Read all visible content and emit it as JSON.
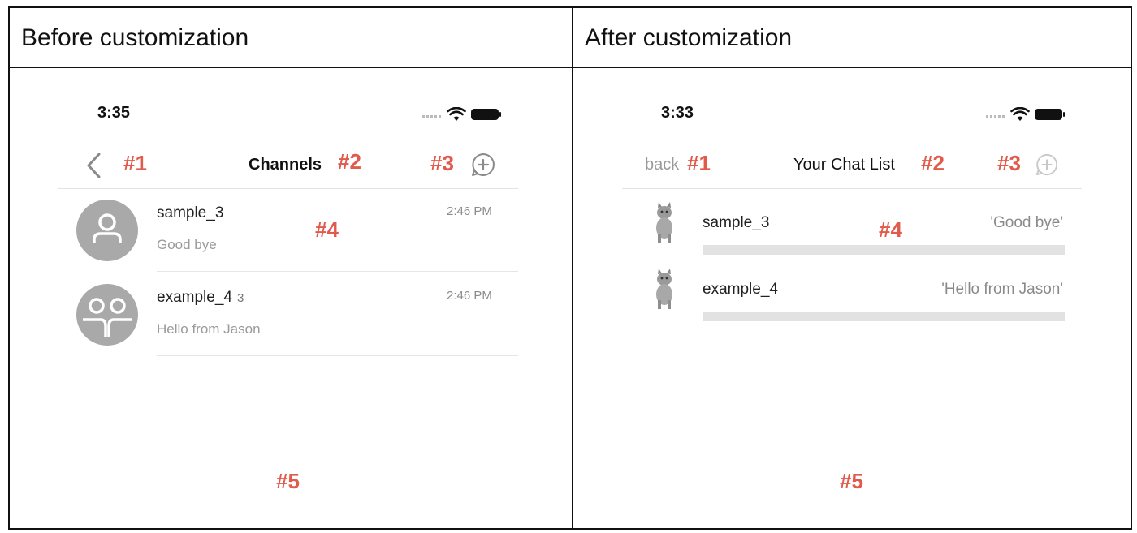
{
  "panels": {
    "before": {
      "title": "Before customization",
      "status_time": "3:35",
      "nav": {
        "title": "Channels",
        "back_icon": "chevron-left-icon",
        "add_icon": "plus-circle-icon"
      },
      "channels": [
        {
          "name": "sample_3",
          "count": "",
          "last_message": "Good bye",
          "time": "2:46 PM"
        },
        {
          "name": "example_4",
          "count": "3",
          "last_message": "Hello from Jason",
          "time": "2:46 PM"
        }
      ],
      "markers": {
        "m1": "#1",
        "m2": "#2",
        "m3": "#3",
        "m4": "#4",
        "m5": "#5"
      }
    },
    "after": {
      "title": "After customization",
      "status_time": "3:33",
      "nav": {
        "back_label": "back",
        "title": "Your Chat List",
        "add_icon": "plus-circle-icon"
      },
      "channels": [
        {
          "name": "sample_3",
          "last_message": "'Good bye'"
        },
        {
          "name": "example_4",
          "last_message": "'Hello from Jason'"
        }
      ],
      "markers": {
        "m1": "#1",
        "m2": "#2",
        "m3": "#3",
        "m4": "#4",
        "m5": "#5"
      }
    }
  },
  "colors": {
    "marker": "#e25a4c",
    "avatar": "#a9a9a9",
    "divider": "#e2e2e2"
  }
}
